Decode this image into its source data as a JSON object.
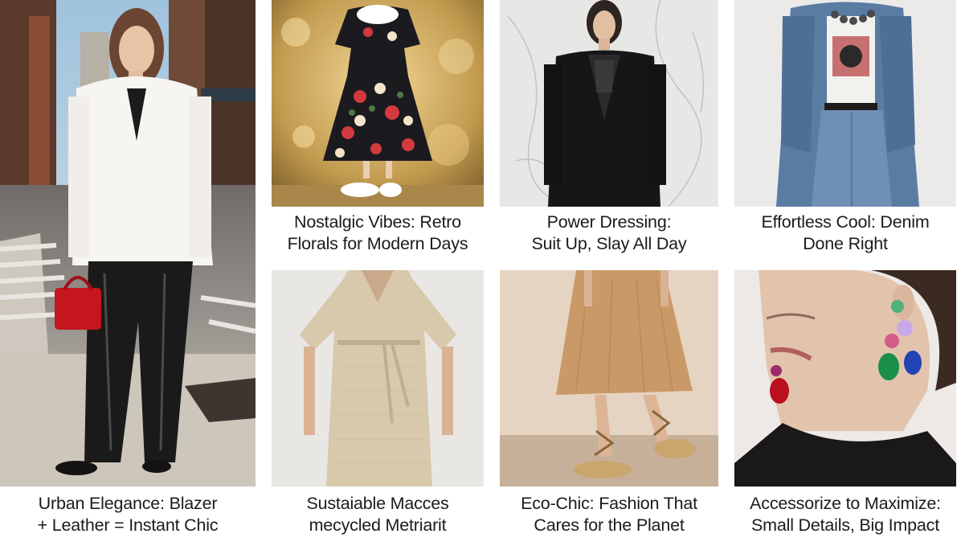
{
  "cards": [
    {
      "caption_line1": "Urban Elegance: Blazer",
      "caption_line2": "+ Leather = Instant Chic"
    },
    {
      "caption_line1": "Nostalgic Vibes: Retro",
      "caption_line2": "Florals for Modern Days"
    },
    {
      "caption_line1": "Power Dressing:",
      "caption_line2": "Suit Up, Slay All Day"
    },
    {
      "caption_line1": "Effortless Cool: Denim",
      "caption_line2": "Done Right"
    },
    {
      "caption_line1": "Sustaiable Macces",
      "caption_line2": "mecycled Metriarit"
    },
    {
      "caption_line1": "Eco-Chic: Fashion That",
      "caption_line2": "Cares for the Planet"
    },
    {
      "caption_line1": "Accessorize to Maximize:",
      "caption_line2": "Small Details, Big Impact"
    }
  ]
}
